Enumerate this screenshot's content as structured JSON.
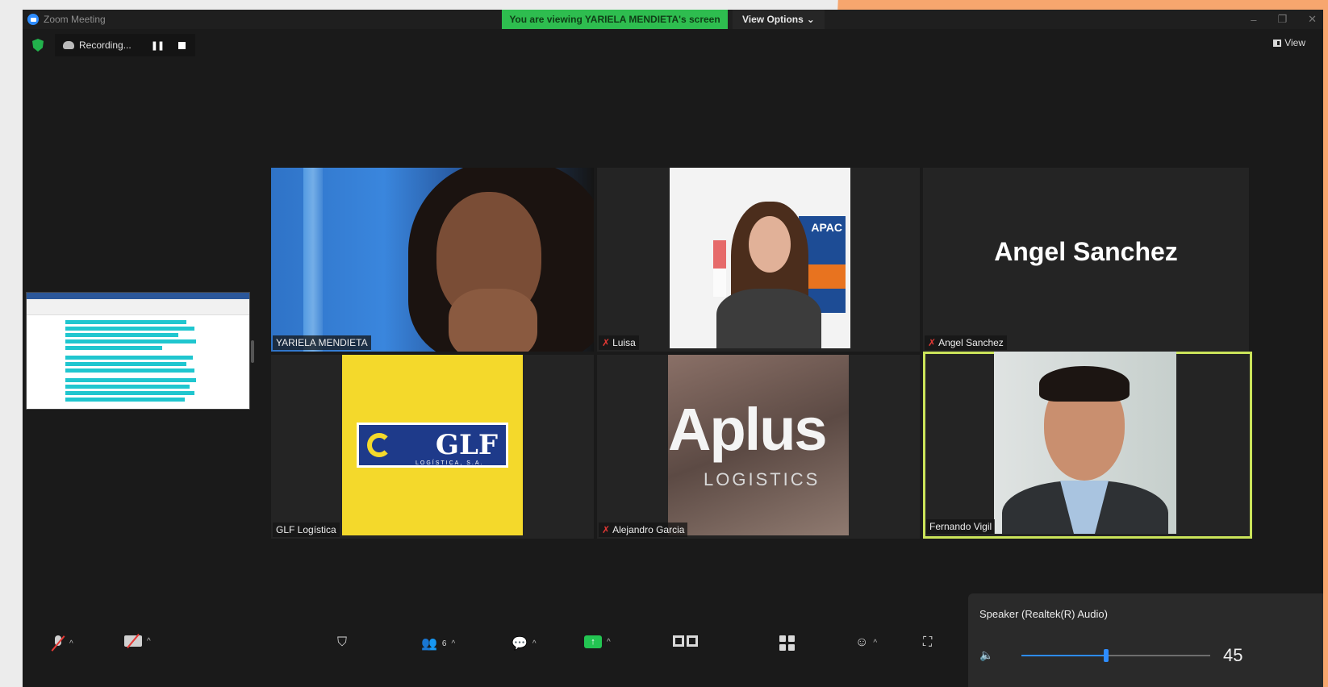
{
  "window": {
    "title": "Zoom Meeting",
    "banner": "You are viewing YARIELA MENDIETA's screen",
    "view_options_label": "View Options",
    "controls": [
      "–",
      "❐",
      "✕"
    ]
  },
  "topbar": {
    "recording_label": "Recording...",
    "view_label": "View"
  },
  "participants": [
    {
      "name": "YARIELA MENDIETA",
      "muted": false
    },
    {
      "name": "Luisa",
      "muted": true
    },
    {
      "name": "Angel Sanchez",
      "muted": true,
      "card_text": "Angel Sanchez"
    },
    {
      "name": "GLF Logística",
      "muted": false
    },
    {
      "name": "Alejandro Garcia",
      "muted": true
    },
    {
      "name": "Fernando Vigil",
      "muted": false,
      "active_speaker": true
    }
  ],
  "logos": {
    "apac": "APAC",
    "glf": "GLF",
    "glf_sub": "LOGÍSTICA, S.A.",
    "aplus": "Aplus",
    "aplus_sub": "LOGISTICS"
  },
  "toolbar": {
    "participant_count": "6"
  },
  "speaker_panel": {
    "label": "Speaker (Realtek(R) Audio)",
    "volume": 45
  },
  "colors": {
    "banner": "#2ebd4f",
    "active_speaker_border": "#cbe45a",
    "accent": "#2d8cff",
    "background_orange": "#f7a66e"
  }
}
